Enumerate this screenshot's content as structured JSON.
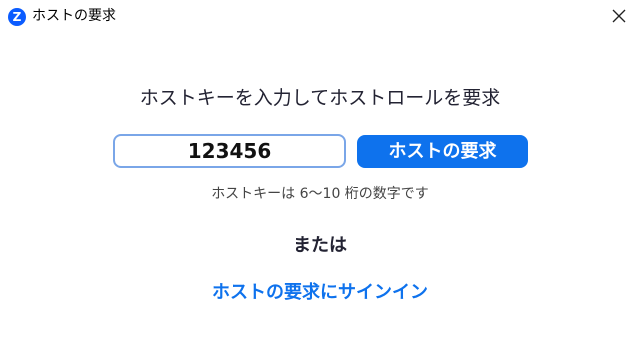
{
  "window": {
    "title": "ホストの要求",
    "logo_letter": "Z",
    "close_icon": "close-icon"
  },
  "main": {
    "heading": "ホストキーを入力してホストロールを要求",
    "host_key_input": {
      "value": "123456",
      "placeholder": ""
    },
    "claim_button_label": "ホストの要求",
    "hint": "ホストキーは 6～10 桁の数字です",
    "or_label": "または",
    "signin_link_label": "ホストの要求にサインイン"
  },
  "colors": {
    "accent": "#0e72ed",
    "logo": "#0b5cff",
    "input_border": "#7aa6e8"
  }
}
